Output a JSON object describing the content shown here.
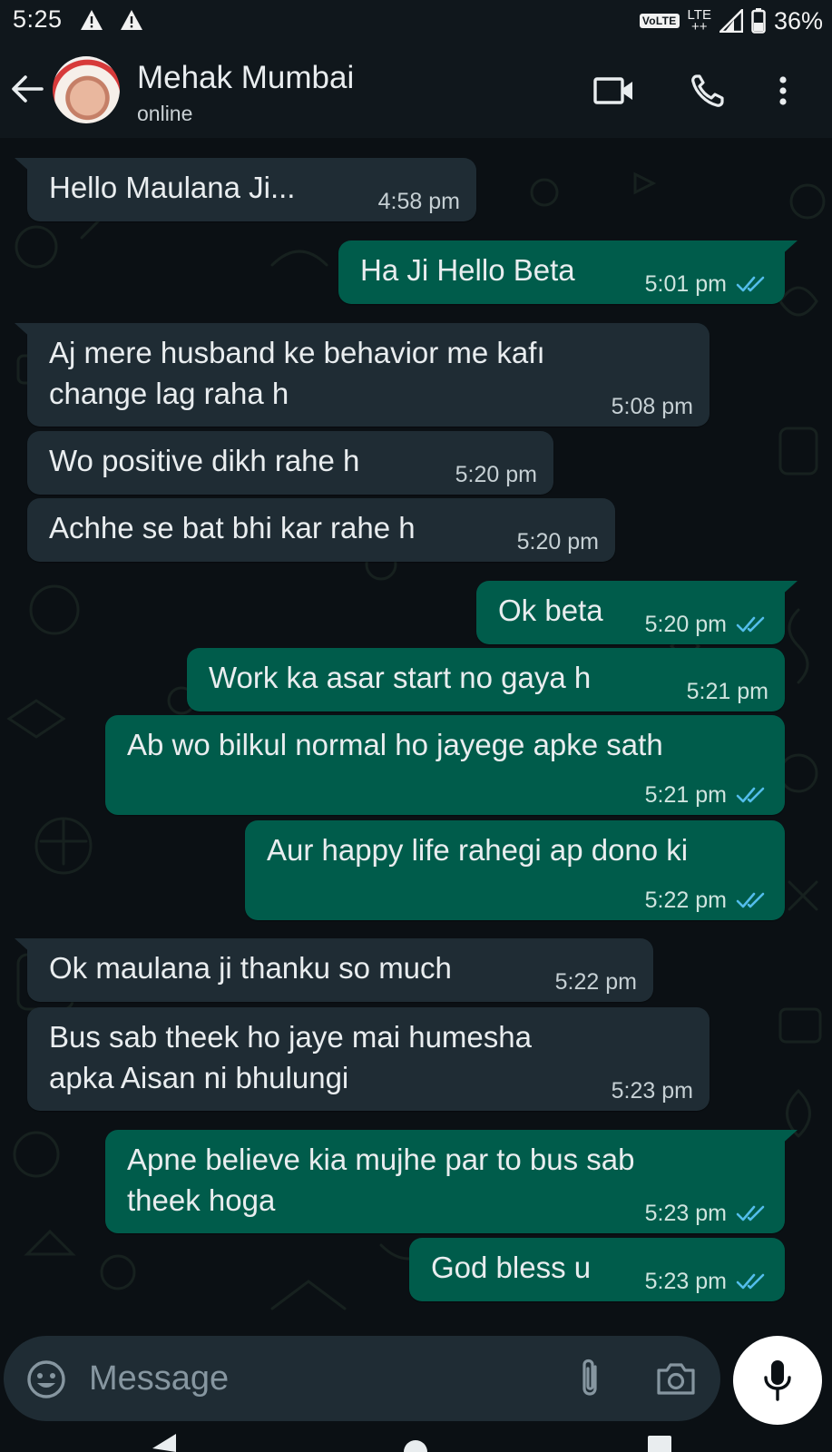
{
  "status_bar": {
    "time": "5:25",
    "volte": "VoLTE",
    "network": "LTE",
    "network_sub": "++",
    "battery": "36%"
  },
  "header": {
    "contact_name": "Mehak Mumbai",
    "status": "online",
    "icons": [
      "back-arrow-icon",
      "video-call-icon",
      "phone-icon",
      "more-options-icon"
    ]
  },
  "messages": [
    {
      "direction": "incoming",
      "text": "Hello Maulana Ji...",
      "time": "4:58 pm"
    },
    {
      "direction": "outgoing",
      "text": "Ha Ji Hello Beta",
      "time": "5:01 pm",
      "status": "read"
    },
    {
      "direction": "incoming",
      "text": "Aj mere husband ke behavior me kafı\nchange lag raha h",
      "time": "5:08 pm"
    },
    {
      "direction": "incoming",
      "text": "Wo positive dikh rahe h",
      "time": "5:20 pm"
    },
    {
      "direction": "incoming",
      "text": "Achhe se bat bhi kar rahe h",
      "time": "5:20 pm"
    },
    {
      "direction": "outgoing",
      "text": "Ok beta",
      "time": "5:20 pm",
      "status": "read"
    },
    {
      "direction": "outgoing",
      "text": "Work ka asar start no gaya h",
      "time": "5:21 pm",
      "status": ""
    },
    {
      "direction": "outgoing",
      "text": "Ab wo bilkul normal ho jayege apke sath",
      "time": "5:21 pm",
      "status": "read"
    },
    {
      "direction": "outgoing",
      "text": "Aur happy life rahegi ap dono ki",
      "time": "5:22 pm",
      "status": "read"
    },
    {
      "direction": "incoming",
      "text": "Ok maulana ji thanku so much",
      "time": "5:22 pm"
    },
    {
      "direction": "incoming",
      "text": "Bus sab theek ho jaye mai humesha\napka Aisan ni bhulungi",
      "time": "5:23 pm"
    },
    {
      "direction": "outgoing",
      "text": "Apne believe kia mujhe par to bus sab\ntheek hoga",
      "time": "5:23 pm",
      "status": "read"
    },
    {
      "direction": "outgoing",
      "text": "God bless u",
      "time": "5:23 pm",
      "status": "read"
    }
  ],
  "composer": {
    "placeholder": "Message"
  },
  "colors": {
    "background": "#0b1014",
    "header": "#10171c",
    "incoming_bubble": "#1f2c34",
    "outgoing_bubble": "#005c4b",
    "read_ticks": "#53bdeb"
  }
}
